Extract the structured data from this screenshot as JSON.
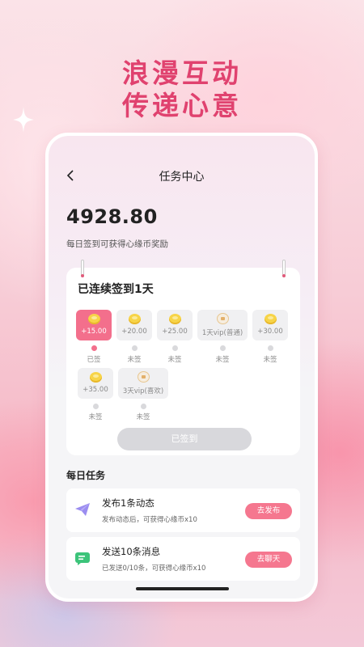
{
  "promo": {
    "headline_line1": "浪漫互动",
    "headline_line2": "传递心意"
  },
  "colors": {
    "accent": "#e0426f",
    "pink_button": "#f5778f",
    "active_day": "#f36f8c",
    "disabled_button": "#d8d8dc"
  },
  "header": {
    "back_icon": "chevron-left-icon",
    "title": "任务中心"
  },
  "balance": {
    "amount": "4928.80",
    "description": "每日签到可获得心缘币奖励"
  },
  "signin": {
    "title": "已连续签到1天",
    "days": [
      {
        "reward": "+15.00",
        "status": "已签",
        "icon": "coin-icon",
        "signed": true
      },
      {
        "reward": "+20.00",
        "status": "未签",
        "icon": "coin-icon",
        "signed": false
      },
      {
        "reward": "+25.00",
        "status": "未签",
        "icon": "coin-icon",
        "signed": false
      },
      {
        "reward": "1天vip(普通)",
        "status": "未签",
        "icon": "vip-icon",
        "signed": false
      },
      {
        "reward": "+30.00",
        "status": "未签",
        "icon": "coin-icon",
        "signed": false
      },
      {
        "reward": "+35.00",
        "status": "未签",
        "icon": "coin-icon",
        "signed": false
      },
      {
        "reward": "3天vip(喜欢)",
        "status": "未签",
        "icon": "vip-icon",
        "signed": false
      }
    ],
    "button_label": "已签到"
  },
  "daily_tasks": {
    "title": "每日任务",
    "items": [
      {
        "title": "发布1条动态",
        "desc": "发布动态后，可获得心缘币x10",
        "button": "去发布",
        "icon": "send-plane-icon"
      },
      {
        "title": "发送10条消息",
        "desc": "已发送0/10条，可获得心缘币x10",
        "button": "去聊天",
        "icon": "chat-message-icon"
      }
    ]
  }
}
